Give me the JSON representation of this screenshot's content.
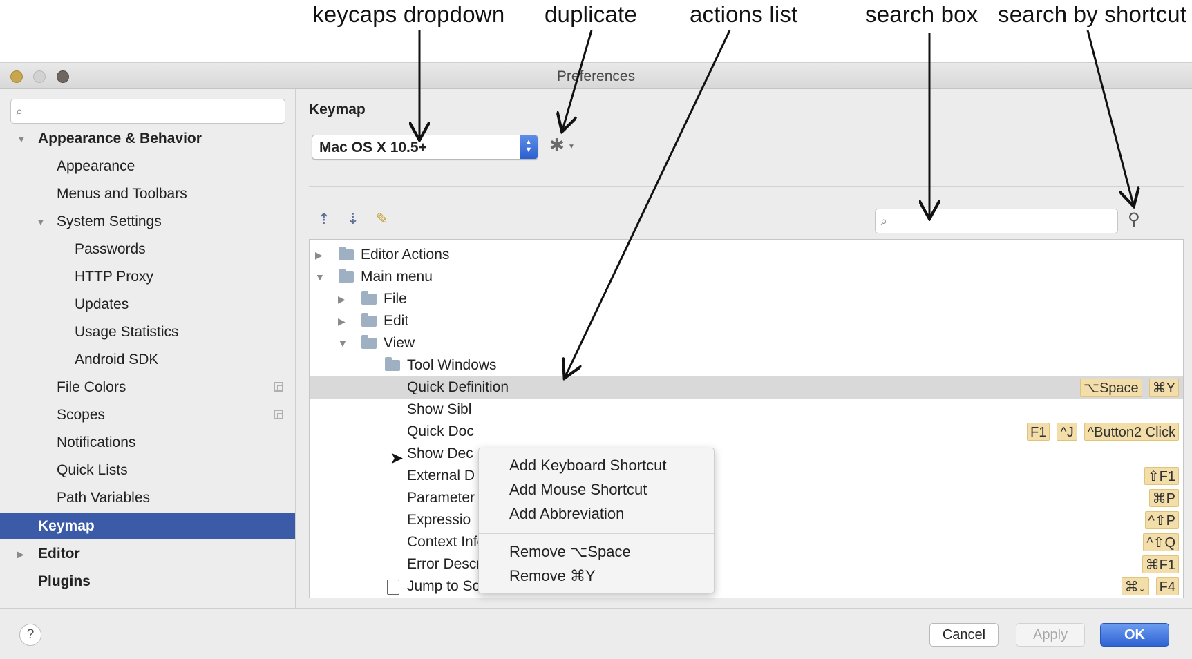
{
  "annotations": {
    "keycaps": "keycaps dropdown",
    "duplicate": "duplicate",
    "actions": "actions list",
    "search": "search box",
    "shortcut": "search by shortcut"
  },
  "window": {
    "title": "Preferences"
  },
  "sidebar": {
    "search_placeholder": "",
    "items": [
      {
        "label": "Appearance & Behavior"
      },
      {
        "label": "Appearance"
      },
      {
        "label": "Menus and Toolbars"
      },
      {
        "label": "System Settings"
      },
      {
        "label": "Passwords"
      },
      {
        "label": "HTTP Proxy"
      },
      {
        "label": "Updates"
      },
      {
        "label": "Usage Statistics"
      },
      {
        "label": "Android SDK"
      },
      {
        "label": "File Colors"
      },
      {
        "label": "Scopes"
      },
      {
        "label": "Notifications"
      },
      {
        "label": "Quick Lists"
      },
      {
        "label": "Path Variables"
      },
      {
        "label": "Keymap"
      },
      {
        "label": "Editor"
      },
      {
        "label": "Plugins"
      }
    ]
  },
  "main": {
    "title": "Keymap",
    "keymap_value": "Mac OS X 10.5+",
    "search_placeholder": ""
  },
  "actions": [
    {
      "label": "Editor Actions",
      "shortcuts": []
    },
    {
      "label": "Main menu",
      "shortcuts": []
    },
    {
      "label": "File",
      "shortcuts": []
    },
    {
      "label": "Edit",
      "shortcuts": []
    },
    {
      "label": "View",
      "shortcuts": []
    },
    {
      "label": "Tool Windows",
      "shortcuts": []
    },
    {
      "label": "Quick Definition",
      "shortcuts": [
        "⌥Space",
        "⌘Y"
      ]
    },
    {
      "label": "Show Sibl",
      "shortcuts": []
    },
    {
      "label": "Quick Doc",
      "shortcuts": [
        "F1",
        "^J",
        "^Button2 Click"
      ]
    },
    {
      "label": "Show Dec",
      "shortcuts": []
    },
    {
      "label": "External D",
      "shortcuts": [
        "⇧F1"
      ]
    },
    {
      "label": "Parameter",
      "shortcuts": [
        "⌘P"
      ]
    },
    {
      "label": "Expressio",
      "shortcuts": [
        "^⇧P"
      ]
    },
    {
      "label": "Context Info",
      "shortcuts": [
        "^⇧Q"
      ]
    },
    {
      "label": "Error Description",
      "shortcuts": [
        "⌘F1"
      ]
    },
    {
      "label": "Jump to Source",
      "shortcuts": [
        "⌘↓",
        "F4"
      ]
    }
  ],
  "context_menu": {
    "items": [
      "Add Keyboard Shortcut",
      "Add Mouse Shortcut",
      "Add Abbreviation",
      "Remove ⌥Space",
      "Remove ⌘Y"
    ]
  },
  "footer": {
    "help": "?",
    "cancel": "Cancel",
    "apply": "Apply",
    "ok": "OK"
  },
  "colors": {
    "selection": "#3b5ba8",
    "ok_button": "#2f63d3",
    "shortcut_bg": "#f3deaa"
  }
}
